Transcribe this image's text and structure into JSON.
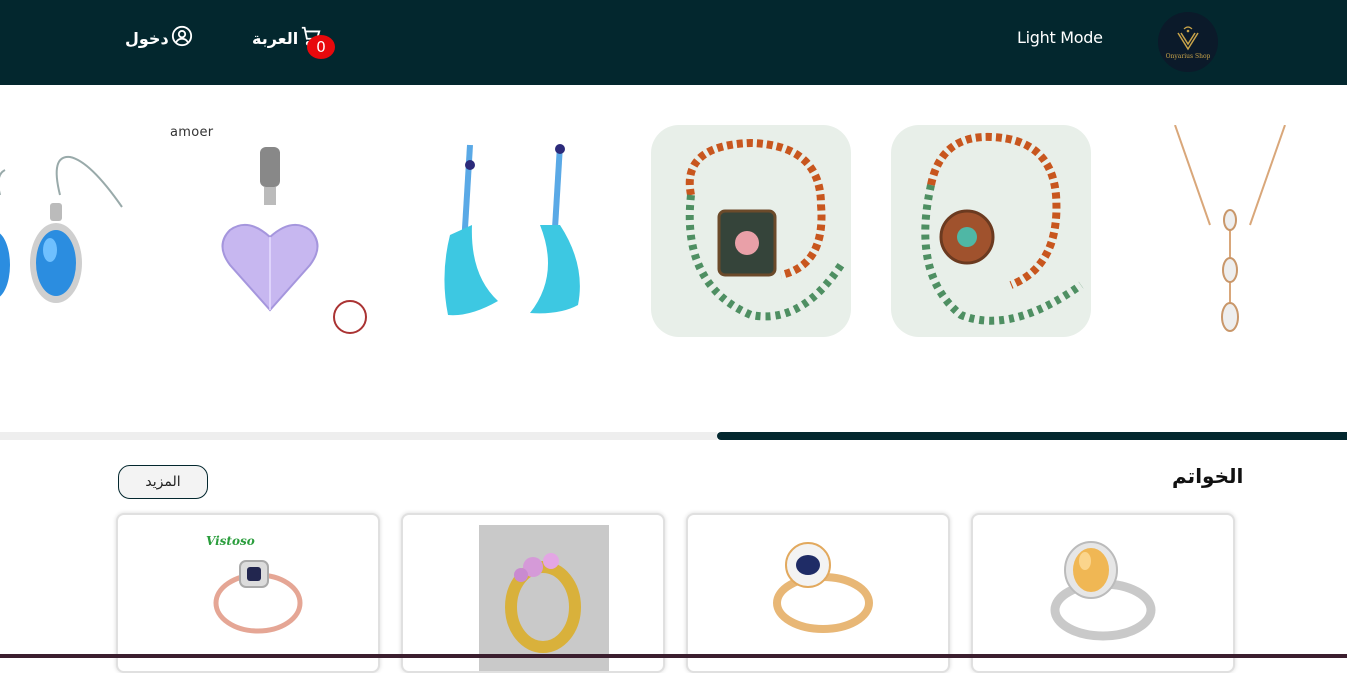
{
  "navbar": {
    "login_label": "دخول",
    "language_label": "العربة",
    "cart_count": "0",
    "mode_label": "Light Mode",
    "logo_text": "Onyarius Shop"
  },
  "carousel": {
    "slides": [
      {
        "name": "blue-oval-earrings"
      },
      {
        "name": "heart-pendant",
        "brand": "amoer"
      },
      {
        "name": "turquoise-earrings"
      },
      {
        "name": "beaded-necklace-square-pendant"
      },
      {
        "name": "beaded-necklace-round-pendant"
      },
      {
        "name": "gold-drop-necklace"
      }
    ],
    "progress": 0.53
  },
  "section": {
    "title": "الخواتم",
    "more_label": "المزيد"
  },
  "products": [
    {
      "name": "citrine-ring"
    },
    {
      "name": "sapphire-halo-ring"
    },
    {
      "name": "pink-gem-ring"
    },
    {
      "name": "rose-gold-ring",
      "brand": "Vistoso"
    }
  ],
  "colors": {
    "navbar": "#03272e",
    "badge": "#e8090c",
    "progress": "#03272e"
  }
}
